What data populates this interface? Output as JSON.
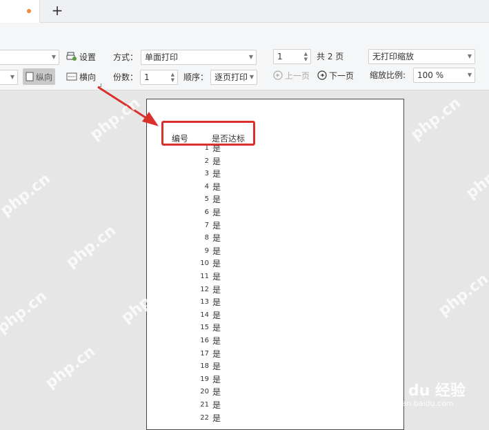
{
  "tabbar": {
    "new_tab_label": "+"
  },
  "toolbar": {
    "setup_label": "设置",
    "portrait_label": "纵向",
    "landscape_label": "横向",
    "mode_label": "方式：",
    "mode_value": "单面打印",
    "copies_label": "份数：",
    "copies_value": "1",
    "order_label": "顺序：",
    "order_value": "逐页打印",
    "page_value": "1",
    "total_pages": "共 2 页",
    "prev_page": "上一页",
    "next_page": "下一页",
    "scale_mode": "无打印缩放",
    "zoom_label": "缩放比例:",
    "zoom_value": "100 %"
  },
  "sheet": {
    "header_col1": "编号",
    "header_col2": "是否达标",
    "rows": [
      {
        "num": "1",
        "val": "是"
      },
      {
        "num": "2",
        "val": "是"
      },
      {
        "num": "3",
        "val": "是"
      },
      {
        "num": "4",
        "val": "是"
      },
      {
        "num": "5",
        "val": "是"
      },
      {
        "num": "6",
        "val": "是"
      },
      {
        "num": "7",
        "val": "是"
      },
      {
        "num": "8",
        "val": "是"
      },
      {
        "num": "9",
        "val": "是"
      },
      {
        "num": "10",
        "val": "是"
      },
      {
        "num": "11",
        "val": "是"
      },
      {
        "num": "12",
        "val": "是"
      },
      {
        "num": "13",
        "val": "是"
      },
      {
        "num": "14",
        "val": "是"
      },
      {
        "num": "15",
        "val": "是"
      },
      {
        "num": "16",
        "val": "是"
      },
      {
        "num": "17",
        "val": "是"
      },
      {
        "num": "18",
        "val": "是"
      },
      {
        "num": "19",
        "val": "是"
      },
      {
        "num": "20",
        "val": "是"
      },
      {
        "num": "21",
        "val": "是"
      },
      {
        "num": "22",
        "val": "是"
      }
    ]
  },
  "watermark": {
    "text": "php.cn",
    "baidu_text": "Bai du 经验",
    "baidu_sub": "jingyan.baidu.com"
  },
  "colors": {
    "highlight": "#d9302c",
    "tab_dot": "#f0883a"
  }
}
